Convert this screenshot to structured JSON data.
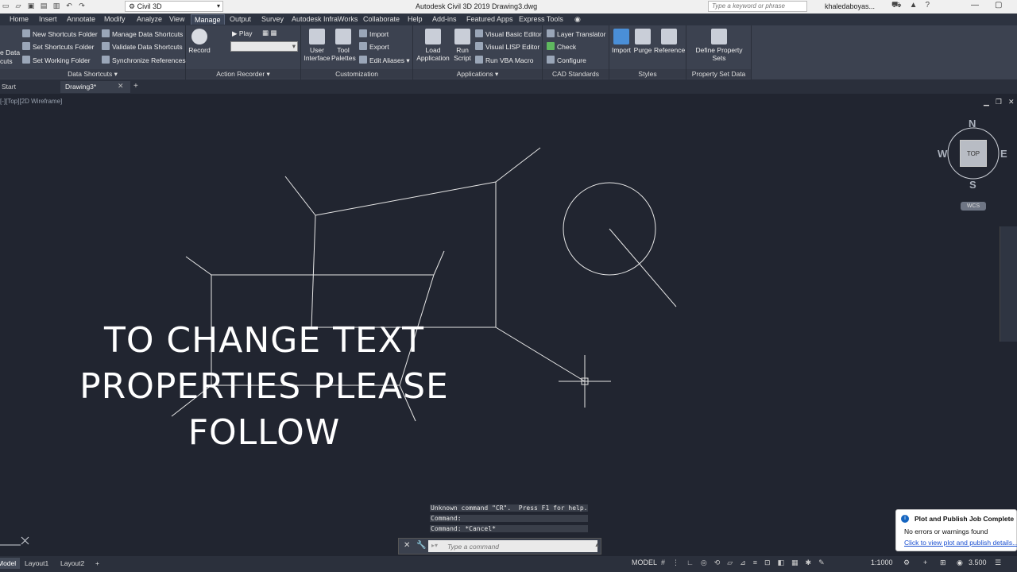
{
  "titlebar": {
    "workspace": "Civil 3D",
    "app_title": "Autodesk Civil 3D 2019    Drawing3.dwg",
    "search_placeholder": "Type a keyword or phrase",
    "user": "khaledaboyas..."
  },
  "menu": {
    "tabs": [
      "Home",
      "Insert",
      "Annotate",
      "Modify",
      "Analyze",
      "View",
      "Manage",
      "Output",
      "Survey",
      "Autodesk InfraWorks",
      "Collaborate",
      "Help",
      "Add-ins",
      "Featured Apps",
      "Express Tools"
    ],
    "active": "Manage"
  },
  "ribbon": {
    "data_shortcuts": {
      "left_clip_1": "e Data",
      "left_clip_2": "cuts",
      "new_folder": "New Shortcuts Folder",
      "set_folder": "Set Shortcuts Folder",
      "working_folder": "Set Working Folder",
      "manage": "Manage Data Shortcuts",
      "validate": "Validate Data Shortcuts",
      "sync": "Synchronize References",
      "title": "Data Shortcuts"
    },
    "action_recorder": {
      "record": "Record",
      "play": "Play",
      "title": "Action Recorder"
    },
    "customization": {
      "cui_1": "User",
      "cui_2": "Interface",
      "tool_1": "Tool",
      "tool_2": "Palettes",
      "import": "Import",
      "export": "Export",
      "edit_aliases": "Edit Aliases",
      "title": "Customization"
    },
    "applications": {
      "load_1": "Load",
      "load_2": "Application",
      "run_1": "Run",
      "run_2": "Script",
      "vba_editor": "Visual Basic Editor",
      "lisp_editor": "Visual LISP Editor",
      "vba_macro": "Run VBA Macro",
      "title": "Applications"
    },
    "cad_standards": {
      "layer_translator": "Layer Translator",
      "check": "Check",
      "configure": "Configure",
      "title": "CAD Standards"
    },
    "styles": {
      "import": "Import",
      "purge": "Purge",
      "reference": "Reference",
      "title": "Styles"
    },
    "property_set_data": {
      "define": "Define Property Sets",
      "title": "Property Set Data"
    }
  },
  "doc_tabs": {
    "start": "Start",
    "drawing": "Drawing3*"
  },
  "viewport": {
    "label": "[-][Top][2D Wireframe]",
    "compass": {
      "n": "N",
      "s": "S",
      "e": "E",
      "w": "W"
    },
    "cube_face": "TOP",
    "wcs": "WCS"
  },
  "overlay_text": [
    "TO CHANGE TEXT",
    "PROPERTIES PLEASE",
    "FOLLOW"
  ],
  "command": {
    "history": [
      "Unknown command \"CR\".  Press F1 for help.",
      "Command:",
      "Command: *Cancel*"
    ],
    "placeholder": "Type a command"
  },
  "statusbar": {
    "layout_tabs": [
      "Model",
      "Layout1",
      "Layout2"
    ],
    "model_label": "MODEL",
    "scale": "1:1000",
    "zoom_value": "3.500"
  },
  "notification": {
    "title": "Plot and Publish Job Complete",
    "message": "No errors or warnings found",
    "link": "Click to view plot and publish details..."
  },
  "colors": {
    "canvas": "#212530",
    "ribbon": "#3c4250",
    "drawing_lines": "#e6e6e6",
    "link": "#1a4fd1"
  }
}
